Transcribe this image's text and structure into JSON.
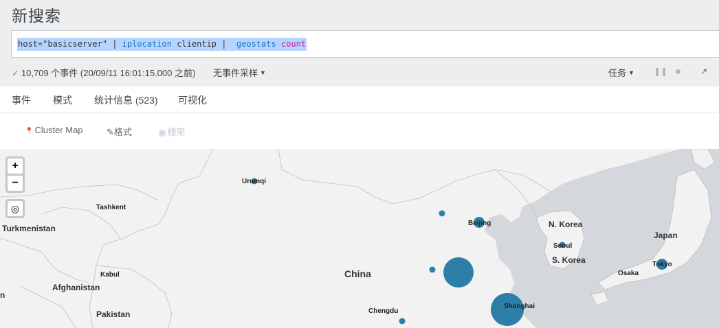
{
  "page_title": "新搜索",
  "search": {
    "part1": "host=\"basicserver\" | ",
    "cmd1": "iplocation",
    "part2": " clientip |  ",
    "cmd2": "geostats",
    "kw": " count"
  },
  "status": {
    "check_icon": "check-icon",
    "events_text": "10,709 个事件 (20/09/11 16:01:15.000 之前)",
    "sampling_label": "无事件采样",
    "jobs_label": "任务"
  },
  "tabs": [
    {
      "label": "事件"
    },
    {
      "label": "模式"
    },
    {
      "label": "统计信息 (523)"
    },
    {
      "label": "可视化"
    }
  ],
  "viz": {
    "type_label": "Cluster Map",
    "format_label": "格式",
    "trellis_label": "棚架"
  },
  "map": {
    "labels": {
      "urumqi": "Urumqi",
      "tashkent": "Tashkent",
      "turkmenistan": "Turkmenistan",
      "kabul": "Kabul",
      "afghanistan": "Afghanistan",
      "pakistan": "Pakistan",
      "china": "China",
      "chengdu": "Chengdu",
      "beijing": "Beijing",
      "nkorea": "N. Korea",
      "seoul": "Seoul",
      "skorea": "S. Korea",
      "japan": "Japan",
      "tokyo": "Tokyo",
      "osaka": "Osaka",
      "shanghai": "Shanghai",
      "edge_n": "n"
    },
    "zoom_in": "+",
    "zoom_out": "−",
    "marker_color": "#2e7fa8"
  }
}
